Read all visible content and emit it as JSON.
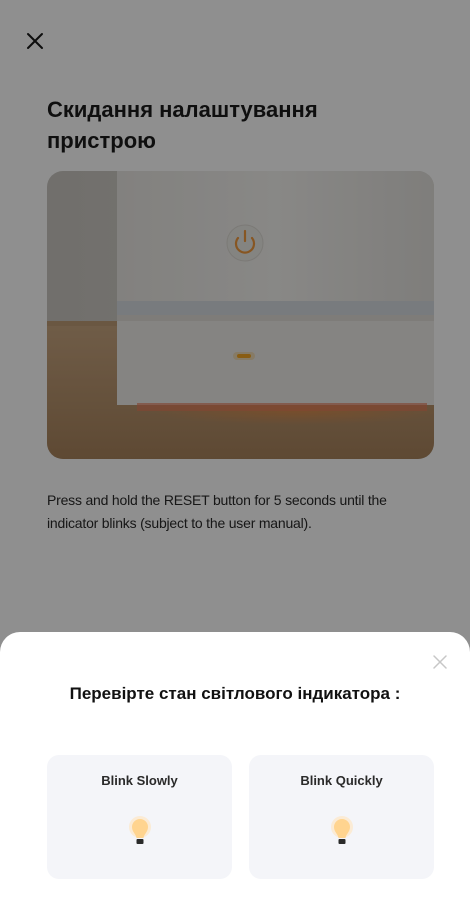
{
  "page": {
    "title": "Скидання налаштування пристрою",
    "instructions": "Press and hold the RESET button for 5 seconds until the indicator blinks (subject to the user manual)."
  },
  "sheet": {
    "title": "Перевірте стан світлового індикатора :",
    "options": [
      {
        "label": "Blink Slowly"
      },
      {
        "label": "Blink Quickly"
      }
    ]
  },
  "colors": {
    "indicator_orange": "#f5a623",
    "bulb_glow": "#ffd9a0",
    "option_bg": "#f4f5f9"
  },
  "icons": {
    "close": "close-icon",
    "bulb": "light-bulb-icon"
  }
}
